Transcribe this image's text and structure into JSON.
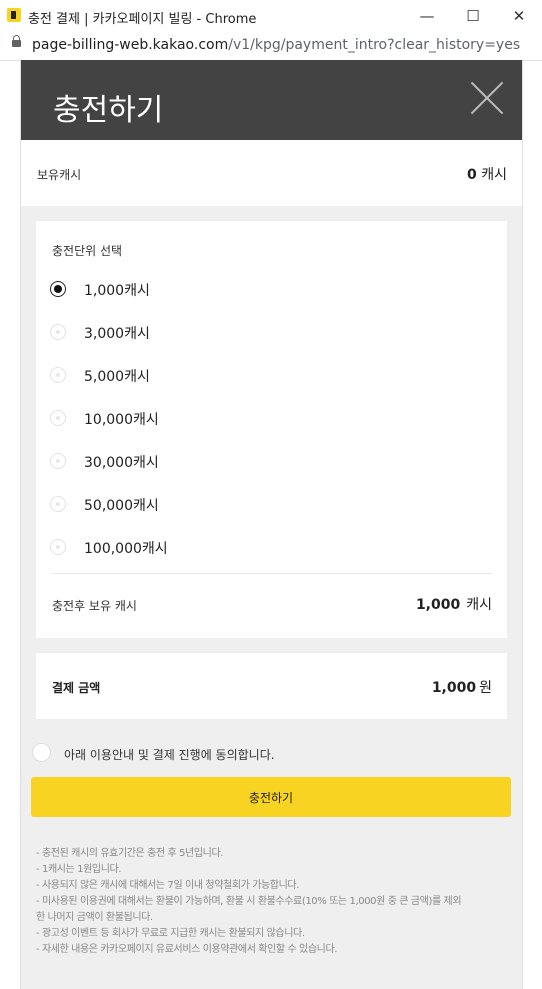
{
  "window": {
    "title": "충전 결제 | 카카오페이지 빌링 - Chrome",
    "minimize_symbol": "—",
    "maximize_symbol": "☐",
    "close_symbol": "✕"
  },
  "address": {
    "host": "page-billing-web.kakao.com",
    "path": "/v1/kpg/payment_intro?clear_history=yes"
  },
  "header": {
    "title": "충전하기"
  },
  "balance": {
    "label": "보유캐시",
    "amount": "0",
    "unit": "캐시"
  },
  "charge_units": {
    "title": "충전단위 선택",
    "options": [
      {
        "label": "1,000캐시",
        "selected": true
      },
      {
        "label": "3,000캐시",
        "selected": false
      },
      {
        "label": "5,000캐시",
        "selected": false
      },
      {
        "label": "10,000캐시",
        "selected": false
      },
      {
        "label": "30,000캐시",
        "selected": false
      },
      {
        "label": "50,000캐시",
        "selected": false
      },
      {
        "label": "100,000캐시",
        "selected": false
      }
    ],
    "after_label": "충전후 보유 캐시",
    "after_amount": "1,000",
    "after_unit": "캐시"
  },
  "payment": {
    "label": "결제 금액",
    "amount": "1,000",
    "unit": "원"
  },
  "agree": {
    "text": "아래 이용안내 및 결제 진행에 동의합니다.",
    "checked": false
  },
  "submit": {
    "label": "충전하기"
  },
  "notes": [
    "- 충전된 캐시의 유효기간은 충전 후 5년입니다.",
    "- 1캐시는 1원입니다.",
    "- 사용되지 않은 캐시에 대해서는 7일 이내 청약철회가 가능합니다.",
    "- 미사용된 이용권에 대해서는 환불이 가능하며, 환불 시 환불수수료(10% 또는 1,000원 중 큰 금액)를 제외",
    "한 나머지 금액이 환불됩니다.",
    "- 광고성 이벤트 등 회사가 무료로 지급한 캐시는 환불되지 않습니다.",
    "- 자세한 내용은 카카오페이지 유료서비스 이용약관에서 확인할 수 있습니다."
  ],
  "colors": {
    "header_bg": "#434343",
    "button_yellow": "#f8d321",
    "page_bg": "#efefef"
  }
}
